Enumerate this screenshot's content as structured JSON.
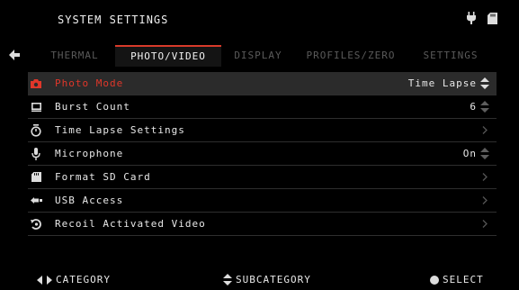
{
  "header": {
    "title": "SYSTEM SETTINGS",
    "icons": [
      "plug-icon",
      "sd-card-icon"
    ]
  },
  "nav": {
    "back_icon": "back-arrow-icon"
  },
  "tabs": [
    {
      "label": "THERMAL",
      "active": false
    },
    {
      "label": "PHOTO/VIDEO",
      "active": true
    },
    {
      "label": "DISPLAY",
      "active": false
    },
    {
      "label": "PROFILES/ZERO",
      "active": false
    },
    {
      "label": "SETTINGS",
      "active": false
    }
  ],
  "menu": [
    {
      "label": "Photo Mode",
      "value": "Time Lapse",
      "control": "updown",
      "selected": true,
      "icon": "camera-icon"
    },
    {
      "label": "Burst Count",
      "value": "6",
      "control": "updown",
      "selected": false,
      "icon": "photos-icon"
    },
    {
      "label": "Time Lapse Settings",
      "value": "",
      "control": "chevron",
      "selected": false,
      "icon": "timer-icon"
    },
    {
      "label": "Microphone",
      "value": "On",
      "control": "updown",
      "selected": false,
      "icon": "microphone-icon"
    },
    {
      "label": "Format SD Card",
      "value": "",
      "control": "chevron",
      "selected": false,
      "icon": "sd-card-icon"
    },
    {
      "label": "USB Access",
      "value": "",
      "control": "chevron",
      "selected": false,
      "icon": "usb-icon"
    },
    {
      "label": "Recoil Activated Video",
      "value": "",
      "control": "chevron",
      "selected": false,
      "icon": "recoil-icon"
    }
  ],
  "footer": {
    "category": "CATEGORY",
    "subcategory": "SUBCATEGORY",
    "select": "SELECT"
  },
  "colors": {
    "accent": "#d83a2a",
    "selected_row": "#2b2b2b",
    "inactive_tab": "#5a5a5a"
  }
}
